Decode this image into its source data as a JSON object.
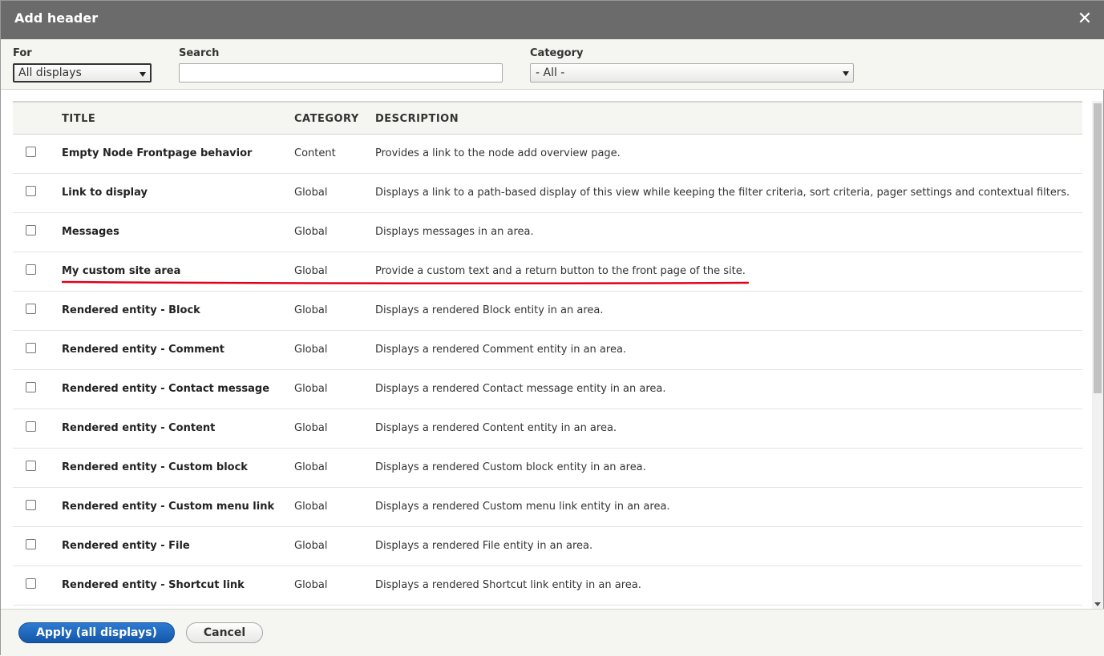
{
  "dialog": {
    "title": "Add header",
    "close_glyph": "✕",
    "close_icon": "close-icon"
  },
  "filters": {
    "for_label": "For",
    "for_value": "All displays",
    "search_label": "Search",
    "search_value": "",
    "category_label": "Category",
    "category_value": "- All -"
  },
  "table": {
    "headers": {
      "title": "TITLE",
      "category": "CATEGORY",
      "description": "DESCRIPTION"
    },
    "rows": [
      {
        "title": "Empty Node Frontpage behavior",
        "category": "Content",
        "description": "Provides a link to the node add overview page."
      },
      {
        "title": "Link to display",
        "category": "Global",
        "description": "Displays a link to a path-based display of this view while keeping the filter criteria, sort criteria, pager settings and contextual filters."
      },
      {
        "title": "Messages",
        "category": "Global",
        "description": "Displays messages in an area."
      },
      {
        "title": "My custom site area",
        "category": "Global",
        "description": "Provide a custom text and a return button to the front page of the site."
      },
      {
        "title": "Rendered entity - Block",
        "category": "Global",
        "description": "Displays a rendered Block entity in an area."
      },
      {
        "title": "Rendered entity - Comment",
        "category": "Global",
        "description": "Displays a rendered Comment entity in an area."
      },
      {
        "title": "Rendered entity - Contact message",
        "category": "Global",
        "description": "Displays a rendered Contact message entity in an area."
      },
      {
        "title": "Rendered entity - Content",
        "category": "Global",
        "description": "Displays a rendered Content entity in an area."
      },
      {
        "title": "Rendered entity - Custom block",
        "category": "Global",
        "description": "Displays a rendered Custom block entity in an area."
      },
      {
        "title": "Rendered entity - Custom menu link",
        "category": "Global",
        "description": "Displays a rendered Custom menu link entity in an area."
      },
      {
        "title": "Rendered entity - File",
        "category": "Global",
        "description": "Displays a rendered File entity in an area."
      },
      {
        "title": "Rendered entity - Shortcut link",
        "category": "Global",
        "description": "Displays a rendered Shortcut link entity in an area."
      }
    ]
  },
  "annotation": {
    "highlight_color": "#e0001b"
  },
  "footer": {
    "apply_label": "Apply (all displays)",
    "cancel_label": "Cancel"
  },
  "colors": {
    "titlebar": "#6b6b6b",
    "primary_button": "#1b62b9",
    "panel_background": "#f5f5f2"
  }
}
